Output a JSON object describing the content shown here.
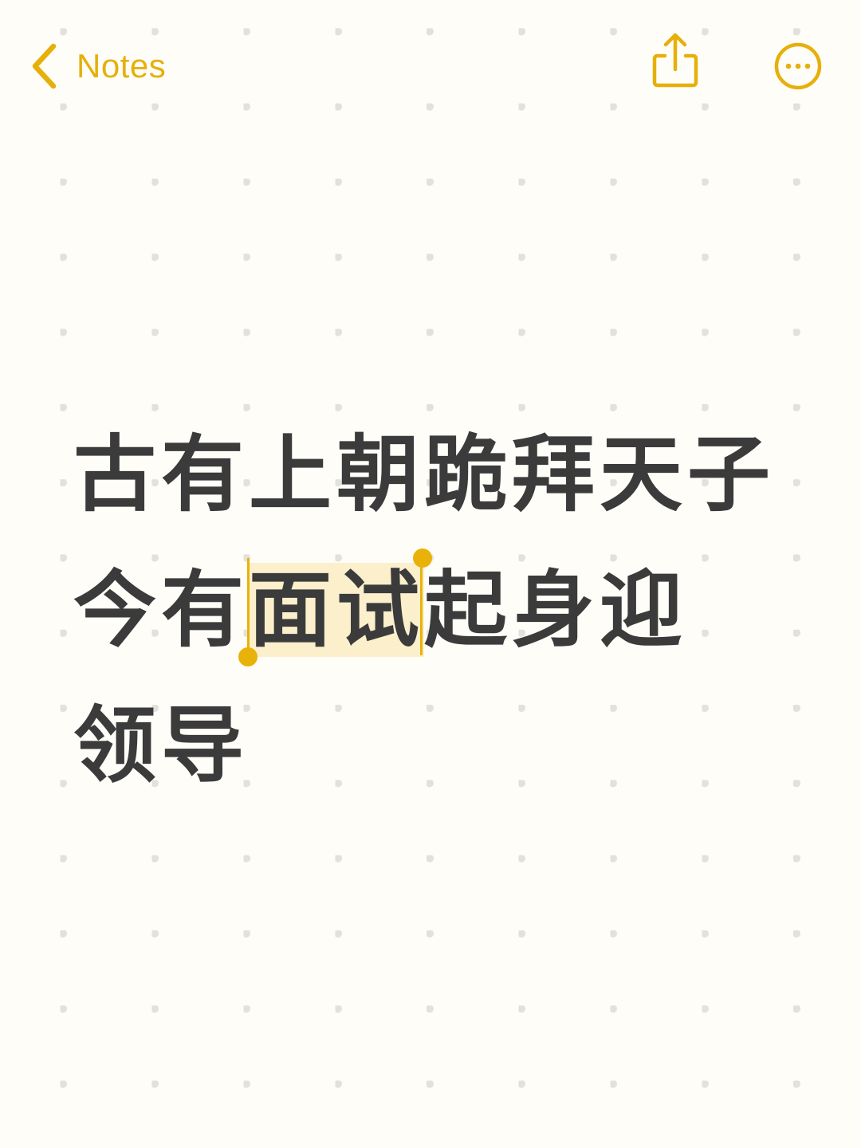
{
  "nav": {
    "back_label": "Notes",
    "back_icon": "chevron-left-icon",
    "share_icon": "share-icon",
    "more_icon": "ellipsis-circle-icon"
  },
  "note": {
    "lines": [
      [
        "古有上朝跪拜天子"
      ],
      [
        "今有",
        "面试",
        "起身迎"
      ],
      [
        "领导"
      ]
    ],
    "selected_text": "面试"
  },
  "colors": {
    "accent": "#e6b00b",
    "text": "#3b3b3b",
    "selection": "#fbefcc",
    "background": "#fffdf8",
    "dots": "#e3e1dc"
  }
}
